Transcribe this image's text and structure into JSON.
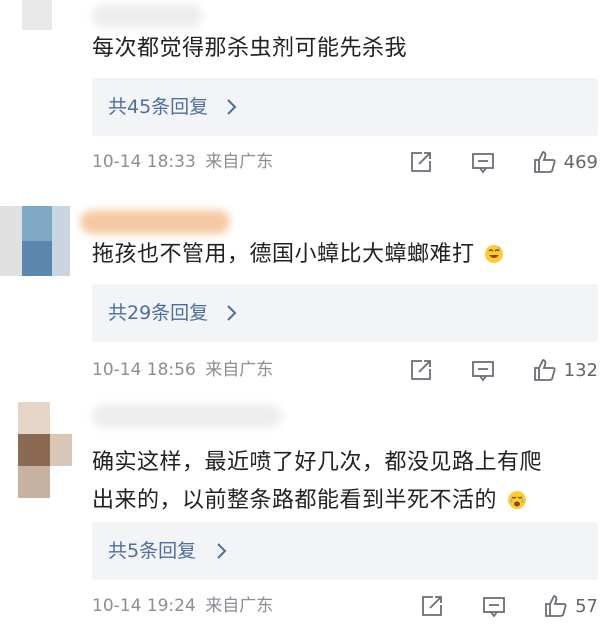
{
  "comments": [
    {
      "text": "每次都觉得那杀虫剂可能先杀我",
      "replies_label": "共45条回复",
      "timestamp": "10-14 18:33",
      "location": "来自广东",
      "likes": "469"
    },
    {
      "text": "拖孩也不管用，德国小蟑比大蟑螂难打",
      "emoji": "grinning-sweat-emoji",
      "replies_label": "共29条回复",
      "timestamp": "10-14 18:56",
      "location": "来自广东",
      "likes": "132"
    },
    {
      "text_line1": "确实这样，最近喷了好几次，都没见路上有爬",
      "text_line2": "出来的，以前整条路都能看到半死不活的",
      "emoji": "crying-face-emoji",
      "replies_label": "共5条回复",
      "timestamp": "10-14 19:24",
      "location": "来自广东",
      "likes": "57"
    }
  ],
  "icons": [
    "share-icon",
    "comment-icon",
    "like-icon",
    "chevron-right-icon",
    "avatar-blurred"
  ],
  "colors": {
    "text": "#222222",
    "link": "#4f6f9b",
    "meta": "#8a8f96",
    "reply_bg": "#f2f4f7"
  }
}
